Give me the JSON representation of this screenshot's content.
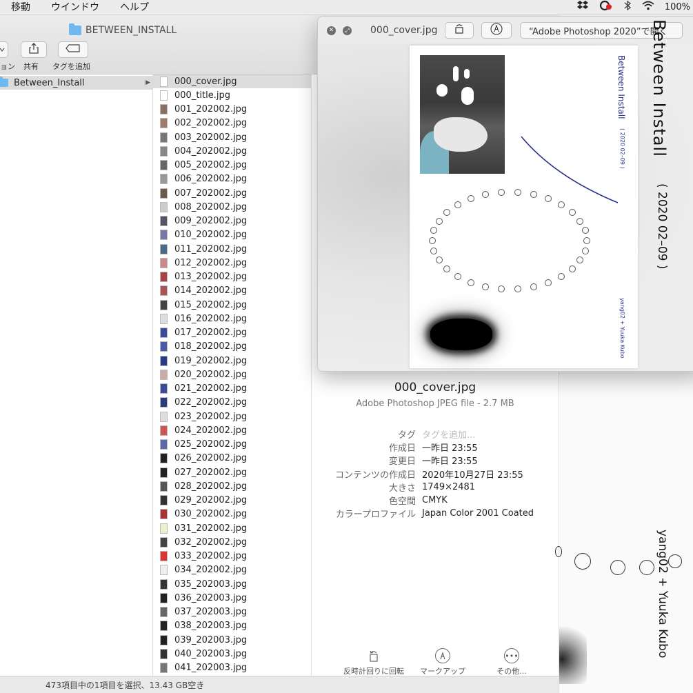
{
  "menubar": {
    "items": [
      "移動",
      "ウインドウ",
      "ヘルプ"
    ],
    "battery": "100%"
  },
  "finder": {
    "title": "BETWEEN_INSTALL",
    "toolbar": {
      "left_label_partial": "ョン",
      "share_label": "共有",
      "tag_label": "タグを追加"
    },
    "sidebar_selected": "Between_Install",
    "files": [
      "000_cover.jpg",
      "000_title.jpg",
      "001_202002.jpg",
      "002_202002.jpg",
      "003_202002.jpg",
      "004_202002.jpg",
      "005_202002.jpg",
      "006_202002.jpg",
      "007_202002.jpg",
      "008_202002.jpg",
      "009_202002.jpg",
      "010_202002.jpg",
      "011_202002.jpg",
      "012_202002.jpg",
      "013_202002.jpg",
      "014_202002.jpg",
      "015_202002.jpg",
      "016_202002.jpg",
      "017_202002.jpg",
      "018_202002.jpg",
      "019_202002.jpg",
      "020_202002.jpg",
      "021_202002.jpg",
      "022_202002.jpg",
      "023_202002.jpg",
      "024_202002.jpg",
      "025_202002.jpg",
      "026_202002.jpg",
      "027_202002.jpg",
      "028_202002.jpg",
      "029_202002.jpg",
      "030_202002.jpg",
      "031_202002.jpg",
      "032_202002.jpg",
      "033_202002.jpg",
      "034_202002.jpg",
      "035_202003.jpg",
      "036_202003.jpg",
      "037_202003.jpg",
      "038_202003.jpg",
      "039_202003.jpg",
      "040_202003.jpg",
      "041_202003.jpg"
    ],
    "selected_file": "000_cover.jpg",
    "preview": {
      "name": "000_cover.jpg",
      "kind": "Adobe Photoshop JPEG file - 2.7 MB",
      "meta": [
        {
          "k": "タグ",
          "v": "タグを追加..."
        },
        {
          "k": "作成日",
          "v": "一昨日 23:55"
        },
        {
          "k": "変更日",
          "v": "一昨日 23:55"
        },
        {
          "k": "コンテンツの作成日",
          "v": "2020年10月27日 23:55"
        },
        {
          "k": "大きさ",
          "v": "1749×2481"
        },
        {
          "k": "色空間",
          "v": "CMYK"
        },
        {
          "k": "カラープロファイル",
          "v": "Japan Color 2001 Coated"
        }
      ],
      "actions": {
        "rotate": "反時計回りに回転",
        "markup": "マークアップ",
        "more": "その他..."
      }
    },
    "status": "473項目中の1項目を選択、13.43 GB空き"
  },
  "quicklook": {
    "title": "000_cover.jpg",
    "open_with": "“Adobe Photoshop 2020”で開く",
    "page": {
      "vertical_title": "Between Install",
      "vertical_date": "( 2020 02–09 )",
      "vertical_author": "yang02 + Yuuka Kubo"
    }
  },
  "background": {
    "big_title": "Between Install",
    "big_date": "( 2020 02–09 )",
    "authors": "yang02 + Yuuka Kubo"
  },
  "colors": {
    "selection": "#dcdcdc",
    "accent_navy": "#2a2f8a",
    "folder": "#6fb8f0"
  }
}
